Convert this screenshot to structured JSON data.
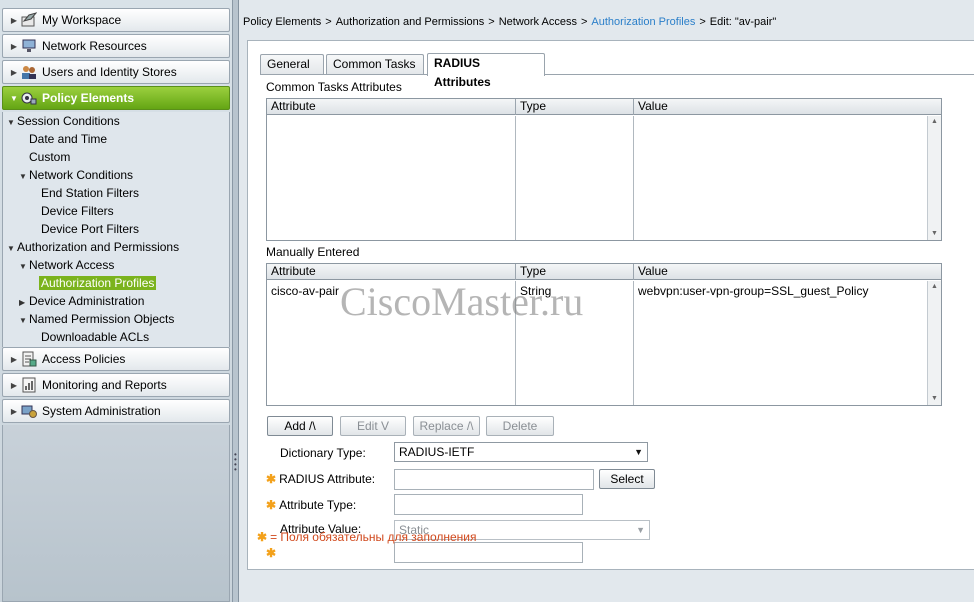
{
  "sidebar": {
    "drawers": [
      {
        "label": "My Workspace",
        "icon": "workspace-icon"
      },
      {
        "label": "Network Resources",
        "icon": "network-resources-icon"
      },
      {
        "label": "Users and Identity Stores",
        "icon": "users-icon"
      },
      {
        "label": "Policy Elements",
        "icon": "policy-elements-icon"
      },
      {
        "label": "Access Policies",
        "icon": "access-policies-icon"
      },
      {
        "label": "Monitoring and Reports",
        "icon": "monitoring-icon"
      },
      {
        "label": "System Administration",
        "icon": "system-admin-icon"
      }
    ],
    "tree": [
      {
        "label": "Session Conditions",
        "expanded": true
      },
      {
        "label": "Date and Time"
      },
      {
        "label": "Custom"
      },
      {
        "label": "Network Conditions",
        "expanded": true
      },
      {
        "label": "End Station Filters"
      },
      {
        "label": "Device Filters"
      },
      {
        "label": "Device Port Filters"
      },
      {
        "label": "Authorization and Permissions",
        "expanded": true
      },
      {
        "label": "Network Access",
        "expanded": true
      },
      {
        "label": "Authorization Profiles",
        "selected": true
      },
      {
        "label": "Device Administration",
        "expanded": false
      },
      {
        "label": "Named Permission Objects",
        "expanded": true
      },
      {
        "label": "Downloadable ACLs"
      }
    ]
  },
  "breadcrumb": {
    "items": [
      "Policy Elements",
      "Authorization and Permissions",
      "Network Access",
      "Authorization Profiles"
    ],
    "current": "Edit: \"av-pair\"",
    "separator": ">"
  },
  "tabs": [
    "General",
    "Common Tasks",
    "RADIUS Attributes"
  ],
  "active_tab": "RADIUS Attributes",
  "common_tasks": {
    "title": "Common Tasks Attributes",
    "columns": [
      "Attribute",
      "Type",
      "Value"
    ],
    "rows": []
  },
  "manual": {
    "title": "Manually Entered",
    "columns": [
      "Attribute",
      "Type",
      "Value"
    ],
    "rows": [
      {
        "attribute": "cisco-av-pair",
        "type": "String",
        "value": "webvpn:user-vpn-group=SSL_guest_Policy"
      }
    ]
  },
  "buttons": {
    "add": "Add /\\",
    "edit": "Edit V",
    "replace": "Replace /\\",
    "delete": "Delete",
    "select": "Select"
  },
  "form": {
    "dictionary_type_label": "Dictionary Type:",
    "dictionary_type_value": "RADIUS-IETF",
    "radius_attribute_label": "RADIUS Attribute:",
    "radius_attribute_value": "",
    "attribute_type_label": "Attribute Type:",
    "attribute_type_value": "",
    "attribute_value_label": "Attribute Value:",
    "attribute_value_value": "Static",
    "extra_value": ""
  },
  "required_symbol": "✱",
  "required_note": "= Поля обязательны для заполнения",
  "watermark": "CiscoMaster.ru",
  "colors": {
    "active_drawer": "#7bb31d",
    "link": "#2b7fc9",
    "required": "#f3a11b",
    "note": "#d0481c"
  }
}
